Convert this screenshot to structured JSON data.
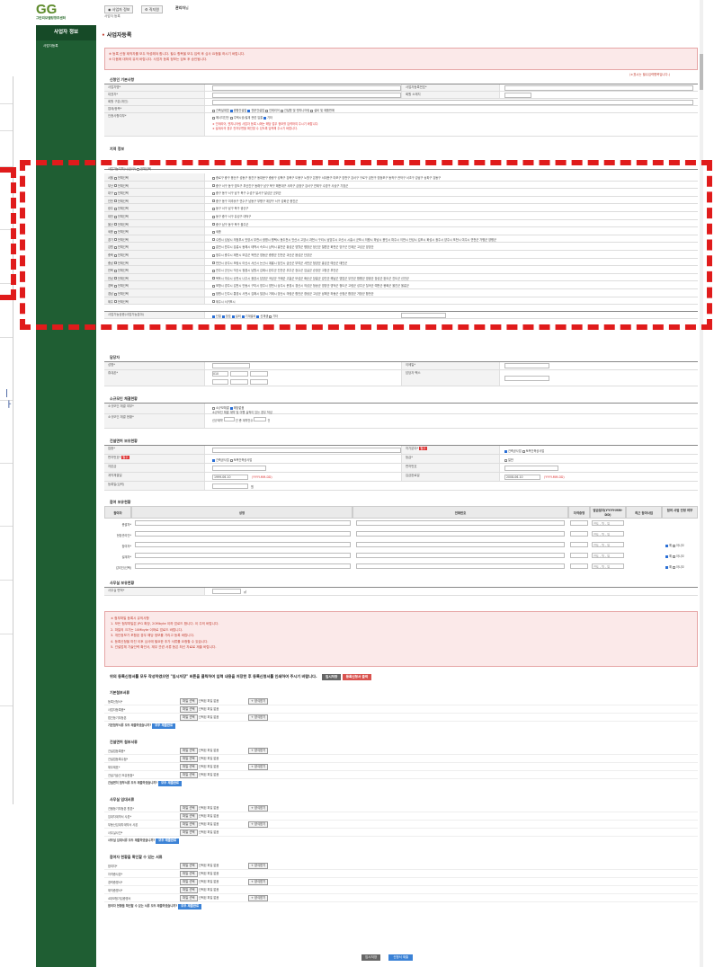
{
  "brand": {
    "logo_text": "GG",
    "org_name": "그린리모델링창조센터"
  },
  "topbar": {
    "buttons": [
      {
        "label": "사업자 정보",
        "icon": "user-icon"
      },
      {
        "label": "직지원",
        "icon": "gear-icon"
      }
    ],
    "user_name": "관리자",
    "user_suffix": "님",
    "breadcrumb": "사업자 등록"
  },
  "sidebar": {
    "title": "사업자 정보",
    "items": [
      {
        "label": "사업자등록"
      }
    ]
  },
  "page": {
    "title": "사업자등록",
    "notice_lines": [
      "※ 등록 신청 제작자를 모두 작성해야 합니다. 필수 항목을 모두 입력 후 심사 요청을 하시기 바랍니다.",
      "※ 다음에 대하여 유의 바랍니다. 사업자 등록 정보는 검토 후 승인됩니다."
    ],
    "required_note": "(∗표시는 필수입력항목입니다.)"
  },
  "basic": {
    "section": "신청인 기본사항",
    "labels": [
      "사업자명*",
      "대표자*",
      "회원 구분(개인)",
      "업태/종목*",
      "사업자구분*",
      "인증사항여부*"
    ],
    "labels_right": [
      "사업자등록번호*",
      "회원 소재지"
    ],
    "biz_options": [
      "건축설계업",
      "종합건설업",
      "전문건설업",
      "인테리어",
      "건설협 및 엔지니어링",
      "설비 및 제품판매",
      "에너지진단",
      "주택시공/설계 관련 입찰",
      "기타"
    ],
    "biz_checked": [
      1,
      2
    ],
    "warn_lines": [
      "∗ 인테리어, 엔지니어링 사업자 등록 시에는 해당 업무 정보를 입력하여 주시기 바랍니다.",
      "∗ 설계사의 경우 전자우편을 확인할 수 있도록 입력해 주시기 바랍니다."
    ]
  },
  "area": {
    "section": "지역 정보",
    "header_label": "사업가능지역(시/군/구)",
    "header_all": "전체선택",
    "all_label": "전체선택",
    "provinces": [
      "서울",
      "부산",
      "대구",
      "인천",
      "광주",
      "대전",
      "울산",
      "세종",
      "경기",
      "강원",
      "충북",
      "충남",
      "전북",
      "전남",
      "경북",
      "경남",
      "제주"
    ],
    "district_lines": [
      "종로구 중구 용산구 성동구 광진구 동대문구 중랑구 성북구 강북구 도봉구 노원구 은평구 서대문구 마포구 양천구 강서구 구로구 금천구 영등포구 동작구 관악구 서초구 강남구 송파구 강동구",
      "중구 서구 동구 영도구 부산진구 동래구 남구 북구 해운대구 사하구 금정구 강서구 연제구 수영구 사상구 기장군",
      "중구 동구 서구 남구 북구 수성구 달서구 달성군 군위군",
      "중구 동구 미추홀구 연수구 남동구 부평구 계양구 서구 강화군 옹진군",
      "동구 서구 남구 북구 광산구",
      "동구 중구 서구 유성구 대덕구",
      "중구 남구 동구 북구 울주군",
      "세종",
      "수원시 성남시 의정부시 안양시 부천시 광명시 평택시 동두천시 안산시 고양시 과천시 구리시 남양주시 오산시 시흥시 군포시 의왕시 하남시 용인시 파주시 이천시 안성시 김포시 화성시 광주시 양주시 포천시 여주시 연천군 가평군 양평군",
      "춘천시 원주시 강릉시 동해시 태백시 속초시 삼척시 홍천군 횡성군 영월군 평창군 정선군 철원군 화천군 양구군 인제군 고성군 양양군",
      "청주시 충주시 제천시 보은군 옥천군 영동군 증평군 진천군 괴산군 음성군 단양군",
      "천안시 공주시 보령시 아산시 서산시 논산시 계룡시 당진시 금산군 부여군 서천군 청양군 홍성군 예산군 태안군",
      "전주시 군산시 익산시 정읍시 남원시 김제시 완주군 진안군 무주군 장수군 임실군 순창군 고창군 부안군",
      "목포시 여수시 순천시 나주시 광양시 담양군 곡성군 구례군 고흥군 보성군 화순군 장흥군 강진군 해남군 영암군 무안군 함평군 영광군 장성군 완도군 진도군 신안군",
      "포항시 경주시 김천시 안동시 구미시 영주시 영천시 상주시 문경시 경산시 의성군 청송군 영양군 영덕군 청도군 고령군 성주군 칠곡군 예천군 봉화군 울진군 울릉군",
      "창원시 진주시 통영시 사천시 김해시 밀양시 거제시 양산시 의령군 함안군 창녕군 고성군 남해군 하동군 산청군 함양군 거창군 합천군",
      "제주시 서귀포시"
    ]
  },
  "trade": {
    "label": "사업가능공종(사업가능분야)",
    "options": [
      "단열",
      "창호",
      "설비",
      "기계설비",
      "신재생",
      "기타"
    ],
    "checked": [
      0,
      1,
      2,
      3,
      4
    ]
  },
  "manager": {
    "section": "담당자",
    "labels": [
      "성명*",
      "휴대폰*",
      "연락처*",
      "이메일*",
      "담당자 팩스"
    ],
    "phone_select": "010",
    "email_domain": "직접입력"
  },
  "tech": {
    "section": "소규모인 체결현황",
    "labels": [
      "소규모인 체결 여부*",
      "소규모인 체결 현황*"
    ],
    "opt_yes": "소규모체결",
    "opt_no": "해당없음",
    "count_note": "소규모인 체결 계약 및 이행 실적이 있는 경우 작성",
    "contract_label": "신규계약",
    "contract_unit": "건",
    "total_label": "총 계약건수",
    "total_unit": "건"
  },
  "license": {
    "section": "건설면허 보유현황",
    "labels": [
      "업종*",
      "면허번호*",
      "자본금",
      "계약체결일",
      "등록일(입력)"
    ],
    "labels_right": [
      "허가분야*",
      "등급*",
      "면허번호",
      "입금완료일"
    ],
    "badge": "필수",
    "date_a": "1999-06-10",
    "date_b": "2008-06-10",
    "date_note": "(YYYY-MM-DD)",
    "unit": "원",
    "radio_a": "건축공사업",
    "radio_b": "토목건축공사업",
    "grade": "일반"
  },
  "personnel": {
    "section": "참여 보유현황",
    "headers": [
      "참여자",
      "성명",
      "생년월일",
      "전화번호",
      "자격증명",
      "발급일자(YYYY-MM-DD)",
      "최근 참여사업",
      "참여 사업 인정 여부"
    ],
    "rows": [
      "총괄자*",
      "현장관리인*",
      "참여자*",
      "설계자*",
      "감리인(선택)"
    ],
    "date_placeholder": "연도 - 월 - 일",
    "yes": "예",
    "no": "아니오"
  },
  "office": {
    "section": "사무실 보유현황",
    "label": "사무실 면적*",
    "unit": "㎡"
  },
  "caution": {
    "lines": [
      "∗ 첨부파일 등록시 유의사항",
      "1. 모든 첨부파일은 JPG 확장, 20Mbyte 이하 업로드 합니다. 이 주의 바랍니다.",
      "2. 파일의 크기는 10Mbyte 이하로 업로드 바랍니다.",
      "3. 개인정보가 포함된 경우 해당 정보를 가리고 등록 바랍니다.",
      "4. 등록신청을 마친 이후 심사에 필요한 추가 서류를 요청할 수 있습니다.",
      "5. 건설업체 기술인력 확인서, 재무 관련 서류 등은 최신 자료로 제출 바랍니다."
    ]
  },
  "upload_intro": {
    "text": "위의 등록신청서를 모두 작성하였으면 \"임시저장\" 버튼을 클릭하여 입력 내용을 저장한 후 등록신청서를 인쇄하여 주시기 바랍니다.",
    "temp_save": "임시저장",
    "print": "등록신청서 출력"
  },
  "uploads": [
    {
      "section": "기본첨부서류",
      "items": [
        "등록신청서*",
        "사업자등록증*",
        "법인등기부등본"
      ],
      "bottom": "기본첨부서류 모두 제출하였습니까?",
      "confirm": "모두 제출완료"
    },
    {
      "section": "건설면허 첨부서류",
      "items": [
        "건설업등록증*",
        "건설업등록수첩*",
        "재무제표*",
        "건설기술인 보유현황*"
      ],
      "bottom": "건설면허 첨부서류 모두 제출하였습니까?",
      "confirm": "모두 제출완료"
    },
    {
      "section": "사무실 임대서류",
      "items": [
        "건물등기부등본 원본*",
        "임대차계약서 사본*",
        "부동산임대차계약서 사본",
        "사무실사진*"
      ],
      "bottom": "사무실 임대서류 모두 제출하였습니까?",
      "confirm": "모두 제출완료"
    },
    {
      "section": "참여자 현황을 확인할 수 있는 서류",
      "items": [
        "참여자*",
        "자격증사본*",
        "경력증명서*",
        "재직증명서*",
        "4대보험가입증명서"
      ],
      "bottom": "참여자 현황을 확인할 수 있는 서류 모두 제출하였습니까?",
      "confirm": "모두 제출완료"
    }
  ],
  "file_btn": "파일 선택",
  "file_none": "선택된 파일 없음",
  "sample_btn": "+ 양식받기",
  "footer": {
    "save": "임시저장",
    "submit": "신청서 제출"
  }
}
